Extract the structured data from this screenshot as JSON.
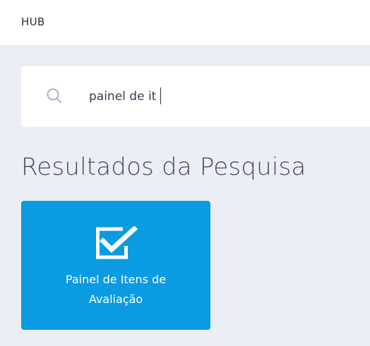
{
  "app": {
    "brand": "HUB"
  },
  "search": {
    "value": "painel de it",
    "icon": "search-icon"
  },
  "results": {
    "title": "Resultados da Pesquisa",
    "items": [
      {
        "label_line1": "Painel de Itens de",
        "label_line2": "Avaliação",
        "icon": "checkbox-checked-icon",
        "color": "#0b9be3"
      }
    ]
  },
  "colors": {
    "background": "#eceef6",
    "card": "#0b9be3",
    "title_text": "#454b60"
  }
}
